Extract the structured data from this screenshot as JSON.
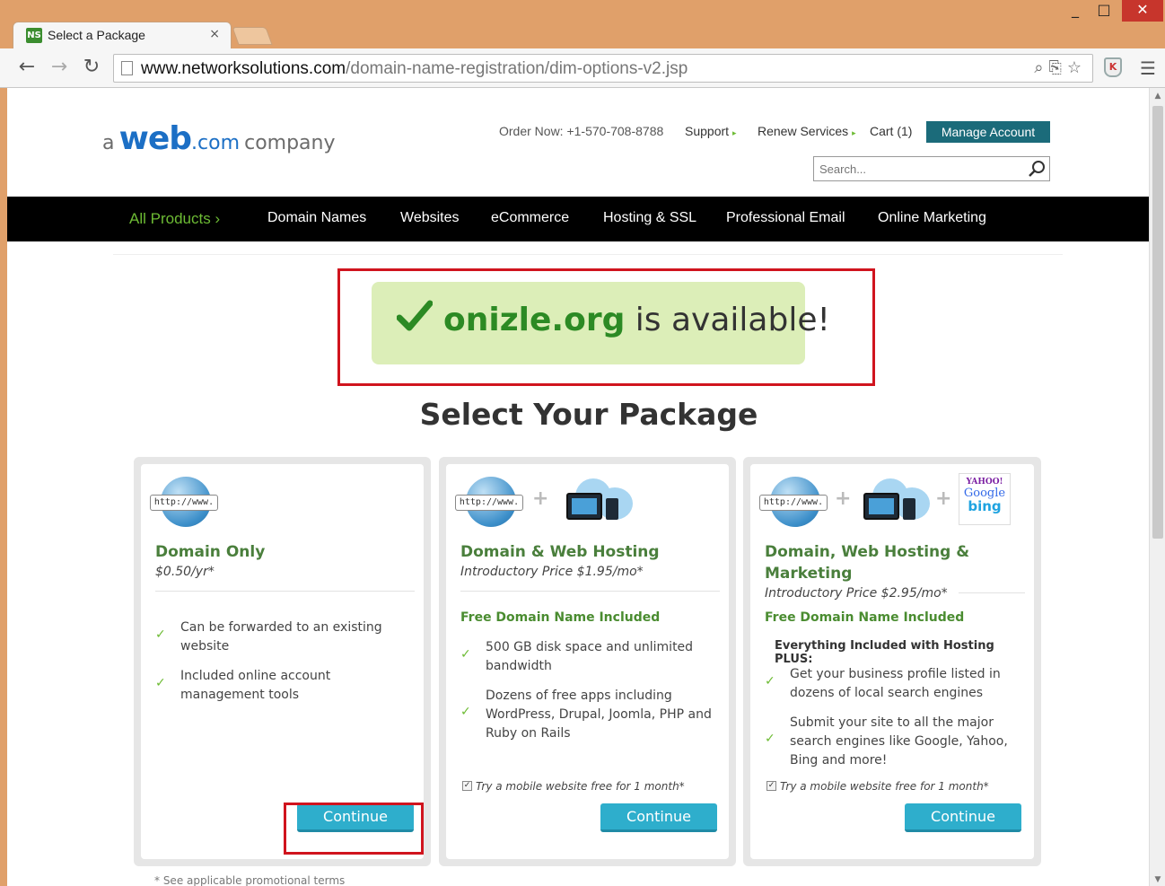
{
  "browser": {
    "tab_title": "Select a Package",
    "tab_favicon": "NS",
    "tab_close": "×",
    "window_min": "_",
    "window_max": "□",
    "window_close": "✕",
    "url_domain": "www.networksolutions.com",
    "url_path": "/domain-name-registration/dim-options-v2.jsp"
  },
  "header": {
    "logo_a": "a",
    "logo_web": "web",
    "logo_com": ".com",
    "logo_company": "company",
    "order_now": "Order Now: +1-570-708-8788",
    "support": "Support",
    "renew": "Renew Services",
    "cart": "Cart (1)",
    "manage_account": "Manage Account",
    "search_placeholder": "Search..."
  },
  "nav": {
    "items": [
      "All Products",
      "Domain Names",
      "Websites",
      "eCommerce",
      "Hosting & SSL",
      "Professional Email",
      "Online Marketing"
    ]
  },
  "availability": {
    "domain": "onizle.org",
    "message": "is available!"
  },
  "section_title": "Select Your Package",
  "packages": [
    {
      "title": "Domain Only",
      "price": "$0.50/yr*",
      "features": [
        "Can be forwarded to an existing website",
        "Included online account management tools"
      ],
      "button": "Continue"
    },
    {
      "title": "Domain & Web Hosting",
      "price": "Introductory Price $1.95/mo*",
      "free_domain": "Free Domain Name Included",
      "features": [
        "500 GB disk space and unlimited bandwidth",
        "Dozens of free apps including WordPress, Drupal, Joomla, PHP and Ruby on Rails"
      ],
      "mobile_option": "Try a mobile website free for 1 month*",
      "button": "Continue"
    },
    {
      "title": "Domain, Web Hosting & Marketing",
      "price": "Introductory Price $2.95/mo*",
      "free_domain": "Free Domain Name Included",
      "plus_heading": "Everything Included with Hosting PLUS:",
      "features": [
        "Get your business profile listed in dozens of local search engines",
        "Submit your site to all the major search engines like Google, Yahoo, Bing and more!"
      ],
      "mobile_option": "Try a mobile website free for 1 month*",
      "button": "Continue"
    }
  ],
  "icon_labels": {
    "globe": "http://www.",
    "yahoo": "YAHOO!",
    "google": "Google",
    "bing": "bing"
  },
  "footnote": "* See applicable promotional terms",
  "colors": {
    "accent_green": "#6dbb34",
    "title_green": "#4a7f3c",
    "continue_blue": "#2eaecc",
    "manage_teal": "#1b6b7a",
    "highlight_red": "#d0141e",
    "available_bg": "#dceeb8"
  }
}
